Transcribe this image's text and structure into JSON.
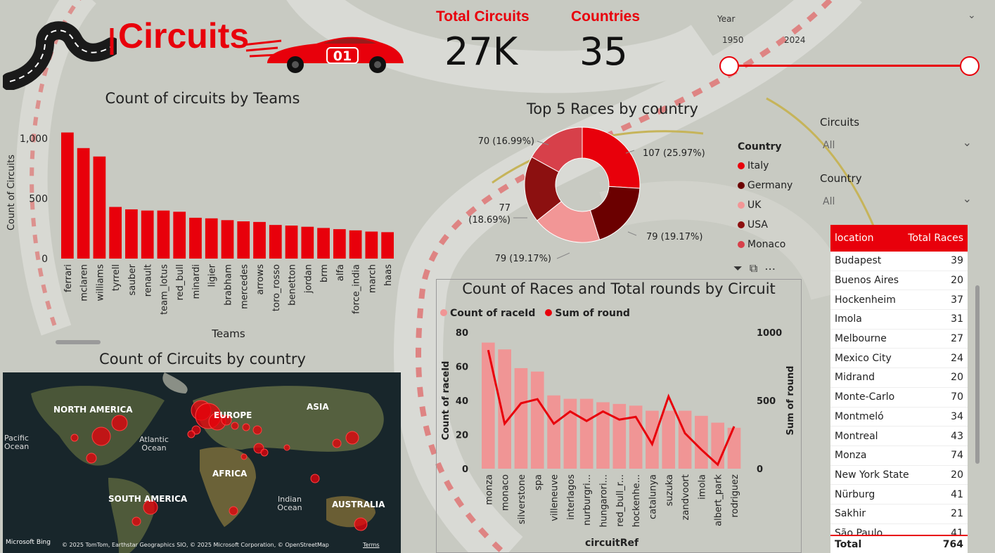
{
  "header": {
    "title": "Circuits",
    "car_number": "01",
    "kpis": [
      {
        "label": "Total Circuits",
        "value": "27K"
      },
      {
        "label": "Countries",
        "value": "35"
      }
    ]
  },
  "year_slicer": {
    "label": "Year",
    "min": "1950",
    "max": "2024"
  },
  "slicers": [
    {
      "label": "Circuits",
      "value": "All"
    },
    {
      "label": "Country",
      "value": "All"
    }
  ],
  "colors": {
    "accent": "#e8000b",
    "bar_light": "#f09595",
    "background": "#c9cbc3"
  },
  "chart_data": [
    {
      "type": "bar",
      "title": "Count of circuits by Teams",
      "xlabel": "Teams",
      "ylabel": "Count of Circuits",
      "ylim": [
        0,
        1100
      ],
      "yticks": [
        "0",
        "500",
        "1,000"
      ],
      "categories": [
        "ferrari",
        "mclaren",
        "williams",
        "tyrrell",
        "sauber",
        "renault",
        "team_lotus",
        "red_bull",
        "minardi",
        "ligier",
        "brabham",
        "mercedes",
        "arrows",
        "toro_rosso",
        "benetton",
        "jordan",
        "brm",
        "alfa",
        "force_india",
        "march",
        "haas"
      ],
      "values": [
        1050,
        920,
        850,
        430,
        410,
        400,
        400,
        390,
        340,
        335,
        320,
        310,
        305,
        280,
        275,
        265,
        255,
        245,
        235,
        225,
        220
      ]
    },
    {
      "type": "pie",
      "title": "Top 5 Races by country",
      "legend_title": "Country",
      "categories": [
        "Italy",
        "Germany",
        "UK",
        "USA",
        "Monaco"
      ],
      "values": [
        107,
        79,
        79,
        77,
        70
      ],
      "labels": [
        "107 (25.97%)",
        "79 (19.17%)",
        "79 (19.17%)",
        "77 (18.69%)",
        "70 (16.99%)"
      ],
      "colors": [
        "#e8000b",
        "#6b0000",
        "#f29696",
        "#8c1010",
        "#d7404a"
      ]
    },
    {
      "type": "bar",
      "title": "Count of Races and Total rounds by Circuit",
      "xlabel": "circuitRef",
      "ylabel": "Count of raceId",
      "y2label": "Sum of round",
      "ylim": [
        0,
        80
      ],
      "y2lim": [
        0,
        1000
      ],
      "yticks": [
        "0",
        "20",
        "40",
        "60",
        "80"
      ],
      "y2ticks": [
        "0",
        "500",
        "1000"
      ],
      "categories": [
        "monza",
        "monaco",
        "silverstone",
        "spa",
        "villeneuve",
        "interlagos",
        "nurburgri...",
        "hungarori...",
        "red_bull_r...",
        "hockenhe...",
        "catalunya",
        "suzuka",
        "zandvoort",
        "imola",
        "albert_park",
        "rodriguez"
      ],
      "series": [
        {
          "name": "Count of raceId",
          "values": [
            74,
            70,
            59,
            57,
            43,
            41,
            41,
            39,
            38,
            37,
            34,
            34,
            34,
            31,
            27,
            24
          ]
        },
        {
          "name": "Sum of round",
          "values": [
            870,
            330,
            480,
            510,
            330,
            420,
            350,
            420,
            360,
            380,
            180,
            530,
            260,
            140,
            30,
            310
          ]
        }
      ]
    }
  ],
  "map": {
    "title": "Count of Circuits by country",
    "labels": [
      "NORTH AMERICA",
      "EUROPE",
      "ASIA",
      "Pacific Ocean",
      "Atlantic Ocean",
      "AFRICA",
      "SOUTH AMERICA",
      "Indian Ocean",
      "AUSTRALIA"
    ],
    "bing": "Microsoft Bing",
    "attribution": "© 2025 TomTom, Earthstar Geographics SIO, © 2025 Microsoft Corporation, © OpenStreetMap",
    "terms": "Terms"
  },
  "table": {
    "headers": [
      "location",
      "Total Races"
    ],
    "rows": [
      [
        "Budapest",
        "39"
      ],
      [
        "Buenos Aires",
        "20"
      ],
      [
        "Hockenheim",
        "37"
      ],
      [
        "Imola",
        "31"
      ],
      [
        "Melbourne",
        "27"
      ],
      [
        "Mexico City",
        "24"
      ],
      [
        "Midrand",
        "20"
      ],
      [
        "Monte-Carlo",
        "70"
      ],
      [
        "Montmeló",
        "34"
      ],
      [
        "Montreal",
        "43"
      ],
      [
        "Monza",
        "74"
      ],
      [
        "New York State",
        "20"
      ],
      [
        "Nürburg",
        "41"
      ],
      [
        "Sakhir",
        "21"
      ],
      [
        "São Paulo",
        "41"
      ]
    ],
    "total_label": "Total",
    "total_value": "764"
  }
}
